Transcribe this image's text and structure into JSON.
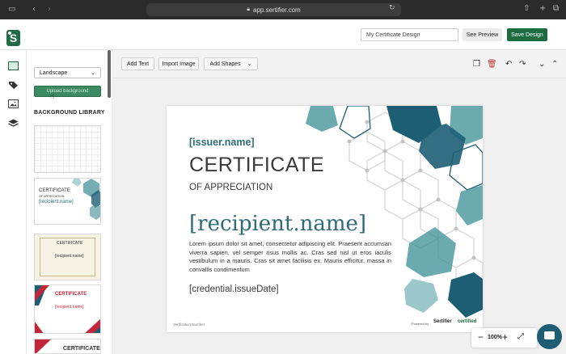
{
  "browser": {
    "url": "app.sertifier.com",
    "icons": [
      "sidebar-icon",
      "back-icon",
      "forward-icon",
      "shield-icon",
      "lock-icon",
      "reload-icon",
      "share-icon",
      "new-tab-icon",
      "tabs-icon"
    ]
  },
  "header": {
    "logo_letter": "S",
    "design_name": "My Certificate Design",
    "preview_label": "See Preview",
    "save_label": "Save Design",
    "accent": "#1d6c41"
  },
  "panel": {
    "orientation": "Landscape",
    "upload_label": "Upload background",
    "library_title": "BACKGROUND LIBRARY",
    "thumb2": {
      "title": "CERTIFICATE",
      "sub": "OF APPRECIATION",
      "name": "[recipient.name]"
    },
    "thumb3": {
      "title": "CERTIFICATE",
      "name": "[recipient.name]"
    },
    "thumb4": {
      "title": "CERTIFICATE",
      "name": "[recipient.name]"
    },
    "thumb5": {
      "title": "CERTIFICATE"
    }
  },
  "toolbar": {
    "add_text": "Add Text",
    "import_image": "Import Image",
    "add_shapes": "Add Shapes"
  },
  "certificate": {
    "issuer": "[issuer.name]",
    "title": "CERTIFICATE",
    "subtitle": "OF APPRECIATION",
    "recipient": "[recipient.name]",
    "body": "Lorem ipsum dolor sit amet, consectetur adipiscing elit. Praesent accumsan viverra sapien, vel semper risus mollis ac. Cras sed nisl ut eros iaculis vestibulum in a mauris. Cras sit amet facilisis ex. Mauris efficitur, massa in convallis condimentum",
    "date": "[credential.issueDate]",
    "verification": "Verification Number",
    "powered": "Powered by",
    "brand_issuer": "Sertifier",
    "brand_verified": "certified",
    "teal": "#2e6b78"
  },
  "zoom": {
    "value": "100%",
    "minus": "−",
    "plus": "+"
  }
}
